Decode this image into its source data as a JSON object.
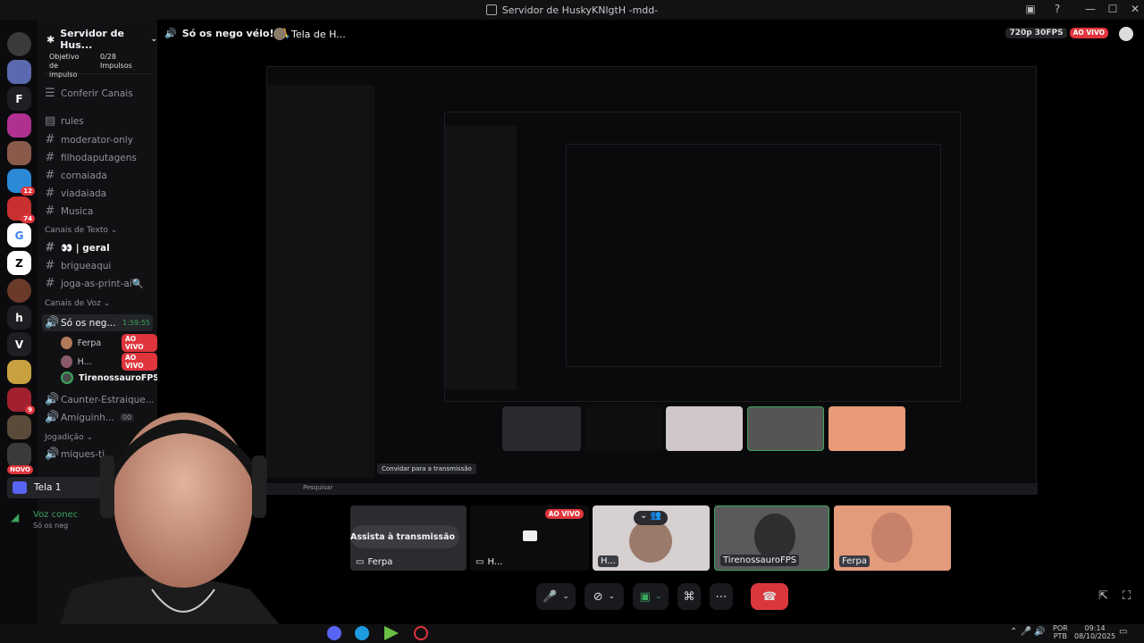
{
  "window": {
    "title": "Servidor de HuskyKNlgtH -mdd-",
    "controls": [
      "—",
      "☐",
      "✕"
    ]
  },
  "server": {
    "name": "Servidor de Hus...",
    "boost_label": "Objetivo de impulso",
    "boost_count": "0/28",
    "boost_unit": "Impulsos"
  },
  "channels": {
    "browse": "Conferir Canais",
    "top": [
      "rules",
      "moderator-only",
      "filhodaputagens",
      "cornaiada",
      "viadaiada",
      "Musica"
    ],
    "text_category": "Canais de Texto",
    "text": [
      "👀 | geral",
      "brigueaqui",
      "joga-as-print-aí🔍"
    ],
    "voice_category": "Canais de Voz",
    "active_voice": "Só os neg...",
    "active_voice_timer": "1:59:55",
    "voice_users": [
      {
        "name": "Ferpa",
        "live": "AO VIVO"
      },
      {
        "name": "H...",
        "live": "AO VIVO"
      },
      {
        "name": "TirenossauroFPS",
        "live": ""
      }
    ],
    "more_voice": [
      "Caunter-Estraique...",
      "Amiguinh..."
    ],
    "amiguinh_count": "00",
    "game_category": "Jogadição",
    "game_channel": "miques-ti..."
  },
  "guild_badges": [
    "12",
    "74",
    "9",
    "NOVO"
  ],
  "guild_letters": [
    "F",
    "h",
    "V"
  ],
  "topbar": {
    "channel": "Só os nego véio!!🙏",
    "screen": "Tela de H...",
    "quality": "720p 30FPS",
    "live": "AO VIVO"
  },
  "stream_panel": {
    "tela": "Tela 1",
    "voice_connected": "Voz conec",
    "voice_sub": "Só os neg"
  },
  "tiles": [
    {
      "label": "Ferpa",
      "overlay": "Assista à transmissão"
    },
    {
      "label": "H...",
      "badge": "AO VIVO"
    },
    {
      "label": "H..."
    },
    {
      "label": "TirenossauroFPS"
    },
    {
      "label": "Ferpa"
    }
  ],
  "mini": {
    "invite": "Convidar para a transmissão",
    "search": "Pesquisar"
  },
  "taskbar": {
    "lang1": "POR",
    "lang2": "PTB",
    "time": "09:14",
    "date": "08/10/2025"
  },
  "colors": {
    "live": "#e0353d",
    "bg": "#000000",
    "sidebar": "#111114",
    "accent_green": "#3ba55d"
  }
}
